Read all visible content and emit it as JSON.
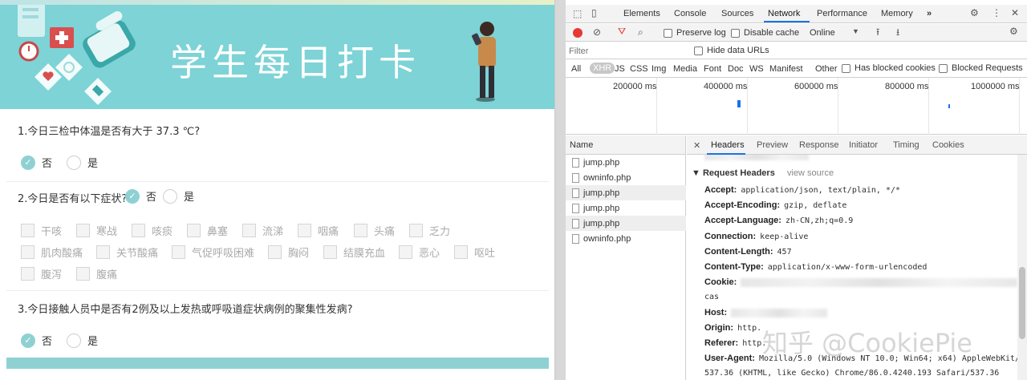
{
  "form": {
    "banner_title": "学生每日打卡",
    "q1": {
      "title": "1.今日三检中体温是否有大于 37.3 ℃?",
      "options": [
        "否",
        "是"
      ],
      "selected": "否"
    },
    "q2": {
      "title": "2.今日是否有以下症状?",
      "options": [
        "否",
        "是"
      ],
      "selected": "否",
      "symptoms": [
        "干咳",
        "寒战",
        "咳痰",
        "鼻塞",
        "流涕",
        "咽痛",
        "头痛",
        "乏力",
        "肌肉酸痛",
        "关节酸痛",
        "气促呼吸困难",
        "胸闷",
        "结膜充血",
        "恶心",
        "呕吐",
        "腹泻",
        "腹痛"
      ]
    },
    "q3": {
      "title": "3.今日接触人员中是否有2例及以上发热或呼吸道症状病例的聚集性发病?",
      "options": [
        "否",
        "是"
      ],
      "selected": "否"
    },
    "accent_color": "#8fd1d3"
  },
  "devtools": {
    "tabs": [
      "Elements",
      "Console",
      "Sources",
      "Network",
      "Performance",
      "Memory"
    ],
    "active_tab": "Network",
    "more_tabs": "»",
    "controls": {
      "preserve_log": "Preserve log",
      "disable_cache": "Disable cache",
      "throttling": "Online"
    },
    "filter_placeholder": "Filter",
    "hide_data_urls": "Hide data URLs",
    "types": [
      "All",
      "XHR",
      "JS",
      "CSS",
      "Img",
      "Media",
      "Font",
      "Doc",
      "WS",
      "Manifest",
      "Other"
    ],
    "active_type": "XHR",
    "has_blocked_cookies": "Has blocked cookies",
    "blocked_requests": "Blocked Requests",
    "timeline_labels": [
      "200000 ms",
      "400000 ms",
      "600000 ms",
      "800000 ms",
      "1000000 ms"
    ],
    "list_header": "Name",
    "requests": [
      "jump.php",
      "owninfo.php",
      "jump.php",
      "jump.php",
      "jump.php",
      "owninfo.php"
    ],
    "detail_tabs": [
      "Headers",
      "Preview",
      "Response",
      "Initiator",
      "Timing",
      "Cookies"
    ],
    "active_detail_tab": "Headers",
    "section_title": "▼ Request Headers",
    "view_source": "view source",
    "headers": [
      {
        "key": "Accept:",
        "value": "application/json, text/plain, */*"
      },
      {
        "key": "Accept-Encoding:",
        "value": "gzip, deflate"
      },
      {
        "key": "Accept-Language:",
        "value": "zh-CN,zh;q=0.9"
      },
      {
        "key": "Connection:",
        "value": "keep-alive"
      },
      {
        "key": "Content-Length:",
        "value": "457"
      },
      {
        "key": "Content-Type:",
        "value": "application/x-www-form-urlencoded"
      },
      {
        "key": "Cookie:",
        "value": ""
      },
      {
        "key": "",
        "value": "cas"
      },
      {
        "key": "Host:",
        "value": ""
      },
      {
        "key": "Origin:",
        "value": "http."
      },
      {
        "key": "Referer:",
        "value": "http."
      },
      {
        "key": "User-Agent:",
        "value": "Mozilla/5.0 (Windows NT 10.0; Win64; x64) AppleWebKit/"
      },
      {
        "key": "",
        "value": "537.36 (KHTML, like Gecko) Chrome/86.0.4240.193 Safari/537.36"
      }
    ],
    "watermark": "知乎 @CookiePie",
    "active_color": "#1a73e8",
    "record_color": "#e53935"
  }
}
